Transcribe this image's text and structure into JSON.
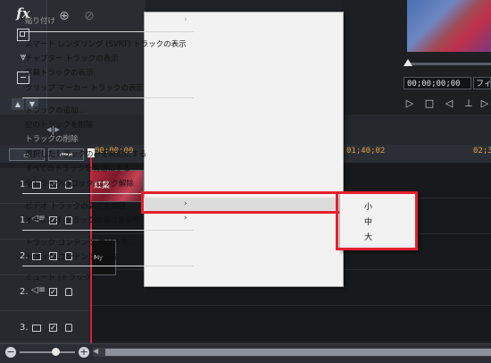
{
  "left_tools": {
    "fx_label": "fx"
  },
  "preview": {
    "timecode": "00;00;00;00",
    "fit_label": "フィッ"
  },
  "ruler": {
    "labels": [
      "00;00;00",
      "01;40;02",
      "02;3"
    ]
  },
  "tracks": [
    {
      "number": "1."
    },
    {
      "number": "1."
    },
    {
      "number": "2."
    },
    {
      "number": "2."
    },
    {
      "number": "3."
    }
  ],
  "clips": {
    "clip1_label": "紅葉",
    "clip2_label": "My"
  },
  "context_menu": {
    "paste": "貼り付け",
    "smart_render": "スマート レンダリング (SVRT) トラックの表示",
    "chapter_track": "チャプター トラックの表示",
    "subtitle_track": "字幕トラックの表示",
    "clip_marker_track": "クリップ マーカー トラックの表示",
    "add_track": "トラックの追加...",
    "delete_empty": "空のトラックを削除",
    "delete_track": "トラックの削除",
    "enable_selected": "選択したトラックのみを有効にする",
    "enable_all": "すべてのトラックを有効にする",
    "lock_all": "全トラックのロック/ロック解除",
    "video_height": "ビデオ トラックの高さを調整",
    "audio_height": "オーディオ トラックの高さを調整",
    "copy_contents": "トラック コンテンツ コピー先...",
    "move_contents": "トラック コンテンツ移動先...",
    "mute": "ミュート (トラック)"
  },
  "submenu": {
    "small": "小",
    "medium": "中",
    "large": "大"
  },
  "colors": {
    "highlight_border": "#e4202e",
    "timecode_accent": "#e2a24a"
  }
}
